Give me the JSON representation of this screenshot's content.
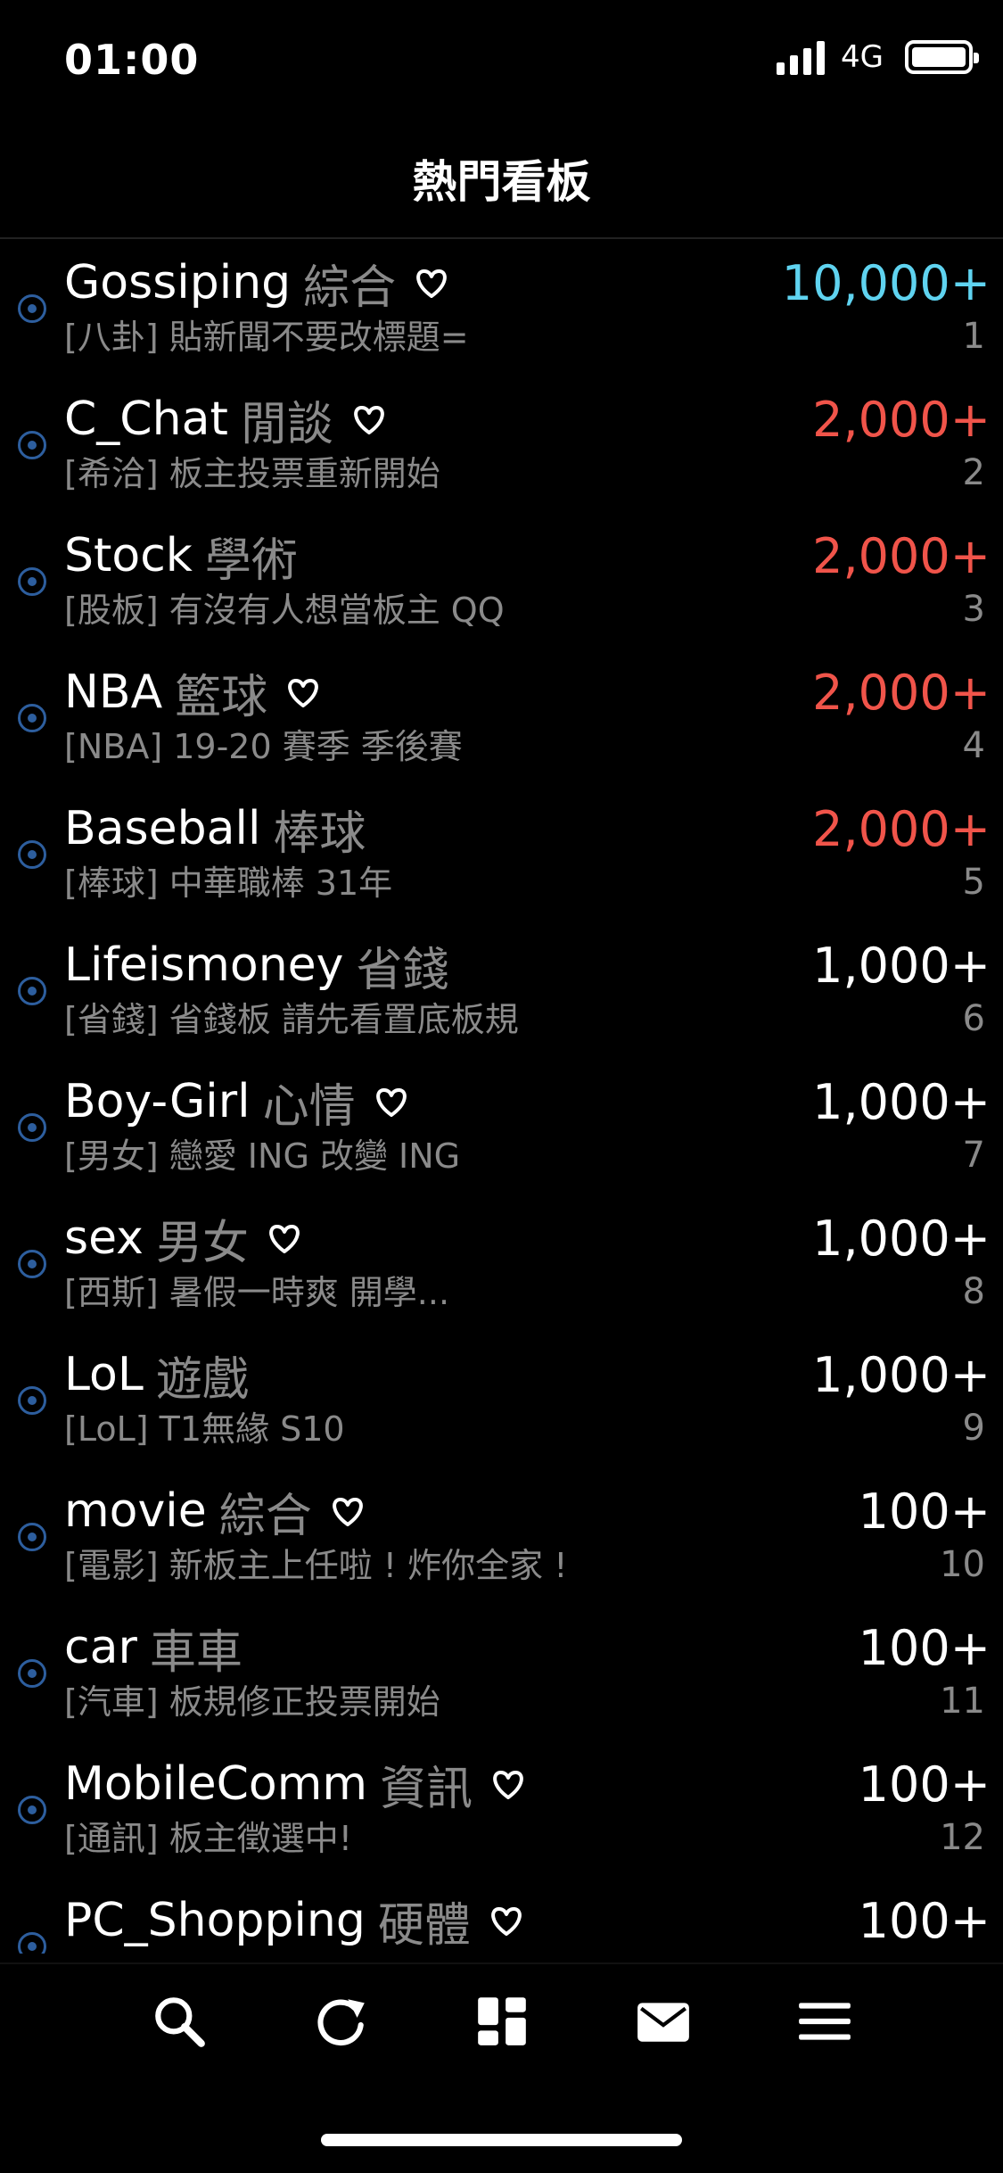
{
  "status_bar": {
    "time": "01:00",
    "network": "4G",
    "battery_level": 1.0
  },
  "header": {
    "title": "熱門看板"
  },
  "boards": [
    {
      "name": "Gossiping",
      "category": "綜合",
      "subtitle": "[八卦] 貼新聞不要改標題=",
      "count": "10,000+",
      "count_color": "#5fd3f0",
      "rank": "1",
      "favorite": true
    },
    {
      "name": "C_Chat",
      "category": "閒談",
      "subtitle": "[希洽] 板主投票重新開始",
      "count": "2,000+",
      "count_color": "#f0544a",
      "rank": "2",
      "favorite": true
    },
    {
      "name": "Stock",
      "category": "學術",
      "subtitle": "[股板] 有沒有人想當板主 QQ",
      "count": "2,000+",
      "count_color": "#f0544a",
      "rank": "3",
      "favorite": false
    },
    {
      "name": "NBA",
      "category": "籃球",
      "subtitle": "[NBA] 19-20 賽季 季後賽",
      "count": "2,000+",
      "count_color": "#f0544a",
      "rank": "4",
      "favorite": true
    },
    {
      "name": "Baseball",
      "category": "棒球",
      "subtitle": "[棒球] 中華職棒 31年",
      "count": "2,000+",
      "count_color": "#f0544a",
      "rank": "5",
      "favorite": false
    },
    {
      "name": "Lifeismoney",
      "category": "省錢",
      "subtitle": "[省錢] 省錢板 請先看置底板規",
      "count": "1,000+",
      "count_color": "#ffffff",
      "rank": "6",
      "favorite": false
    },
    {
      "name": "Boy-Girl",
      "category": "心情",
      "subtitle": "[男女] 戀愛 ING 改變 ING",
      "count": "1,000+",
      "count_color": "#ffffff",
      "rank": "7",
      "favorite": true
    },
    {
      "name": "sex",
      "category": "男女",
      "subtitle": "[西斯] 暑假一時爽 開學...",
      "count": "1,000+",
      "count_color": "#ffffff",
      "rank": "8",
      "favorite": true
    },
    {
      "name": "LoL",
      "category": "遊戲",
      "subtitle": "[LoL] T1無緣 S10",
      "count": "1,000+",
      "count_color": "#ffffff",
      "rank": "9",
      "favorite": false
    },
    {
      "name": "movie",
      "category": "綜合",
      "subtitle": "[電影] 新板主上任啦 ! 炸你全家 !",
      "count": "100+",
      "count_color": "#ffffff",
      "rank": "10",
      "favorite": true
    },
    {
      "name": "car",
      "category": "車車",
      "subtitle": "[汽車] 板規修正投票開始",
      "count": "100+",
      "count_color": "#ffffff",
      "rank": "11",
      "favorite": false
    },
    {
      "name": "MobileComm",
      "category": "資訊",
      "subtitle": "[通訊] 板主徵選中!",
      "count": "100+",
      "count_color": "#ffffff",
      "rank": "12",
      "favorite": true
    },
    {
      "name": "PC_Shopping",
      "category": "硬體",
      "subtitle": "",
      "count": "100+",
      "count_color": "#ffffff",
      "rank": "",
      "favorite": true
    }
  ],
  "tab_bar": {
    "items": [
      {
        "icon": "search-icon"
      },
      {
        "icon": "refresh-icon"
      },
      {
        "icon": "boards-grid-icon"
      },
      {
        "icon": "mail-icon"
      },
      {
        "icon": "menu-icon"
      }
    ]
  }
}
